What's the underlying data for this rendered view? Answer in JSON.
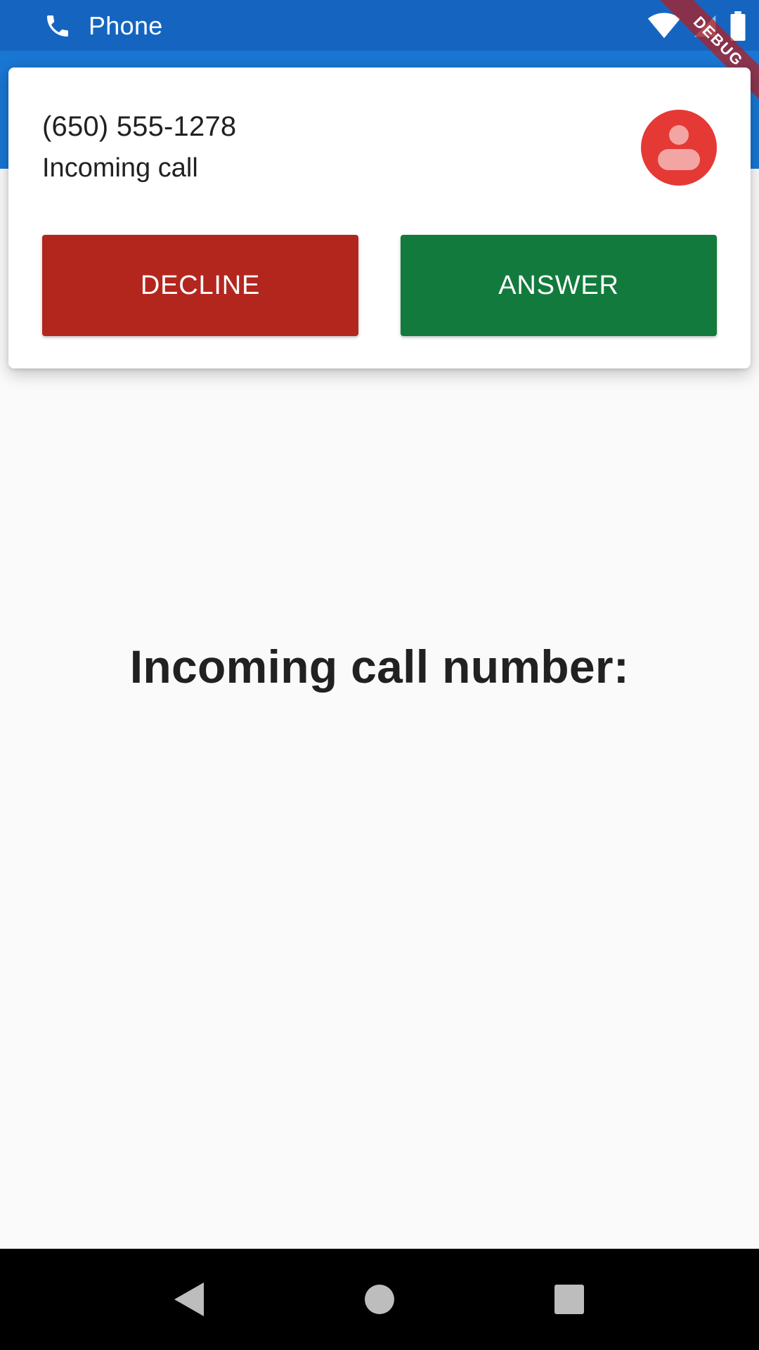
{
  "status_bar": {
    "title": "Phone",
    "icons": [
      "phone-icon",
      "wifi-icon",
      "cell-signal-icon",
      "battery-icon"
    ]
  },
  "debug_banner": {
    "label": "DEBUG"
  },
  "notification": {
    "caller_number": "(650) 555-1278",
    "status_text": "Incoming call",
    "avatar_icon": "person-icon",
    "decline_label": "DECLINE",
    "answer_label": "ANSWER"
  },
  "main": {
    "heading": "Incoming call number:"
  },
  "nav_bar": {
    "icons": [
      "back-icon",
      "home-icon",
      "recents-icon"
    ]
  },
  "colors": {
    "status_bar": "#1565c0",
    "app_bar": "#1976d2",
    "decline": "#b3261e",
    "answer": "#137a3d",
    "avatar": "#e53935"
  }
}
